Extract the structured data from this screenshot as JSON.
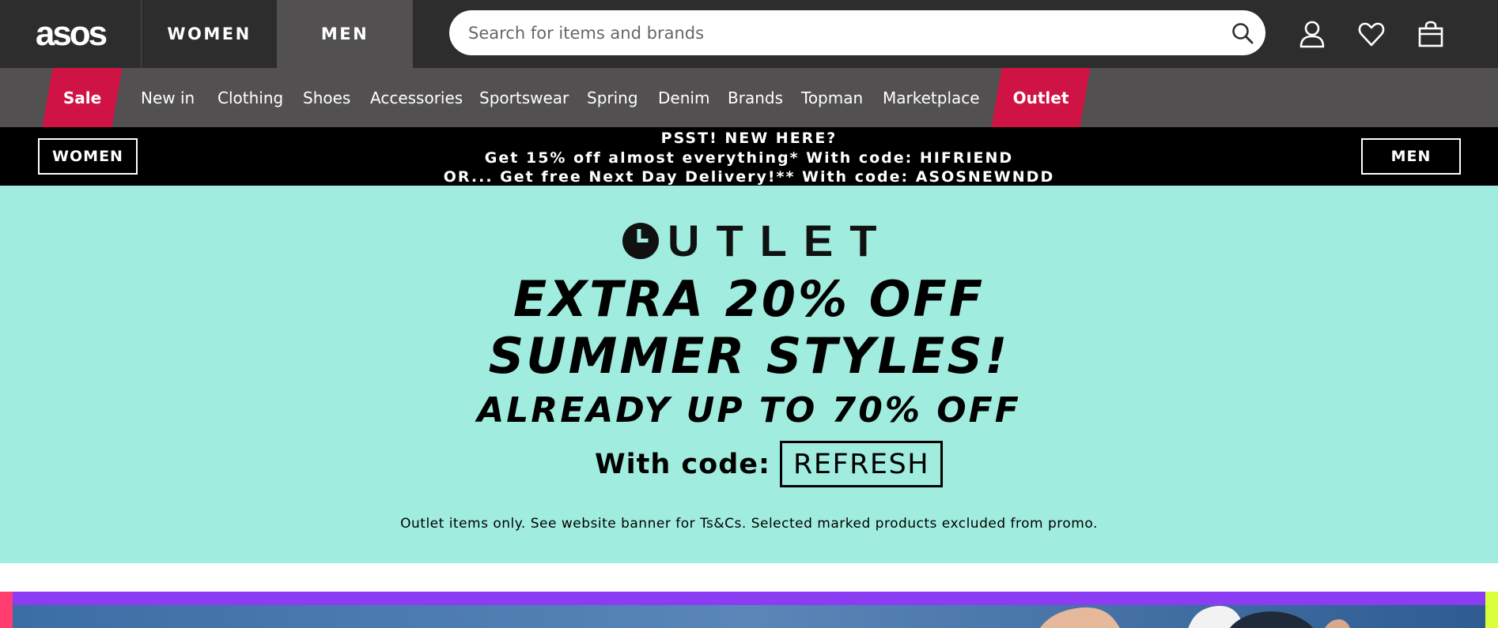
{
  "header": {
    "logo": "asos",
    "tabs": [
      {
        "label": "WOMEN",
        "active": false
      },
      {
        "label": "MEN",
        "active": true
      }
    ],
    "search": {
      "placeholder": "Search for items and brands",
      "value": ""
    },
    "icons": [
      "search-icon",
      "account-icon",
      "heart-icon",
      "bag-icon"
    ]
  },
  "nav": {
    "items": [
      {
        "label": "Sale",
        "highlight": true
      },
      {
        "label": "New in"
      },
      {
        "label": "Clothing"
      },
      {
        "label": "Shoes"
      },
      {
        "label": "Accessories"
      },
      {
        "label": "Sportswear"
      },
      {
        "label": "Spring"
      },
      {
        "label": "Denim"
      },
      {
        "label": "Brands"
      },
      {
        "label": "Topman"
      },
      {
        "label": "Marketplace"
      },
      {
        "label": "Outlet",
        "highlight": true
      }
    ],
    "highlight_color": "#d01345"
  },
  "promo": {
    "line1": "PSST! NEW HERE?",
    "line2": "Get 15% off almost everything* With code: HIFRIEND",
    "line3": "OR... Get free Next Day Delivery!** With code: ASOSNEWNDD",
    "women_button": "WOMEN",
    "men_button": "MEN"
  },
  "hero": {
    "brand": "OUTLET",
    "headline1": "EXTRA 20% OFF",
    "headline2": "SUMMER STYLES!",
    "subheadline": "ALREADY UP TO 70% OFF",
    "code_label": "With code:",
    "code": "REFRESH",
    "terms": "Outlet items only. See website banner for Ts&Cs. Selected marked products excluded from promo.",
    "background": "#a0ede0"
  },
  "colors": {
    "header_bg": "#2d2d2d",
    "nav_bg": "#525050",
    "accent": "#d01345"
  }
}
